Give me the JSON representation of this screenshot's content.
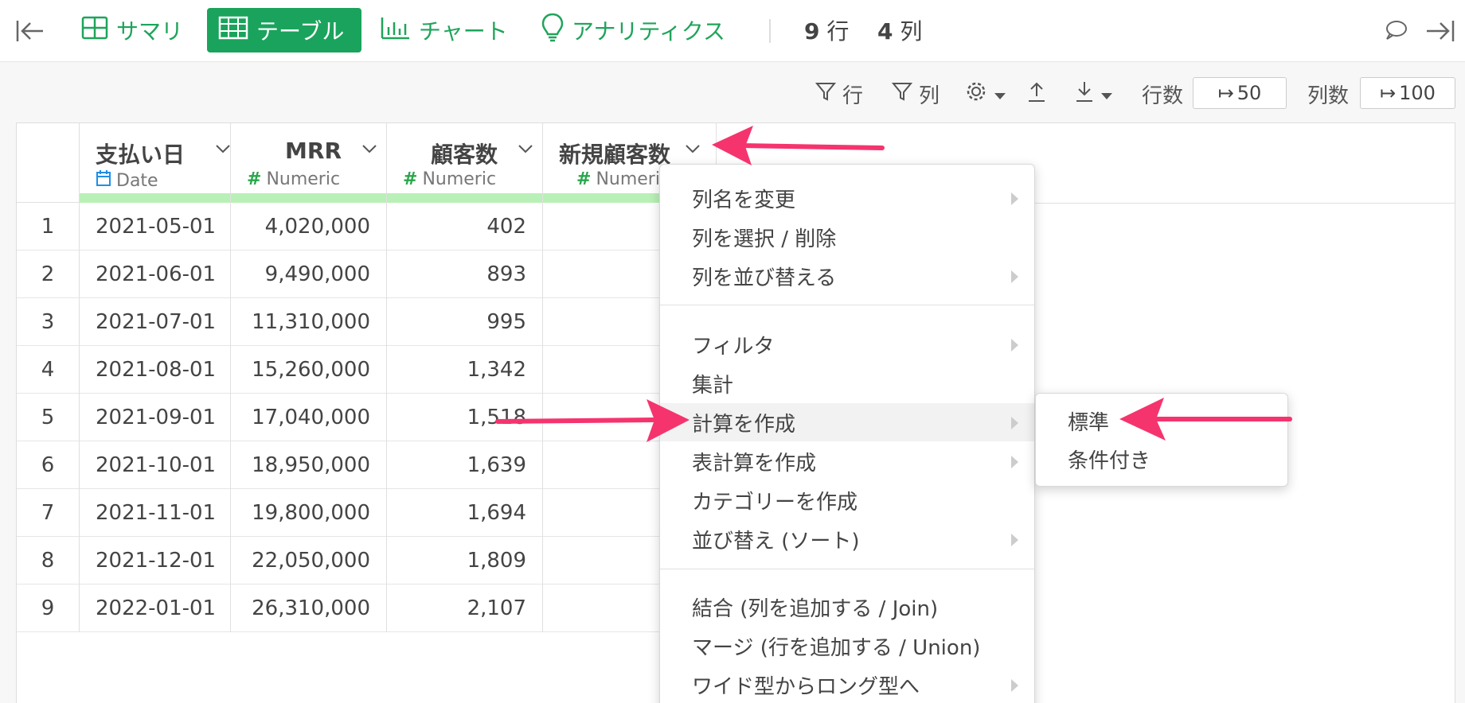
{
  "nav": {
    "summary": "サマリ",
    "table": "テーブル",
    "chart": "チャート",
    "analytics": "アナリティクス",
    "rows_count": "9",
    "rows_unit": "行",
    "cols_count": "4",
    "cols_unit": "列"
  },
  "toolbar": {
    "row_filter": "行",
    "col_filter": "列",
    "rows_label": "行数",
    "rows_value": "50",
    "cols_label": "列数",
    "cols_value": "100"
  },
  "table": {
    "columns": [
      {
        "name": "支払い日",
        "type": "Date"
      },
      {
        "name": "MRR",
        "type": "Numeric"
      },
      {
        "name": "顧客数",
        "type": "Numeric"
      },
      {
        "name": "新規顧客数",
        "type": "Numeri"
      }
    ],
    "rows": [
      {
        "n": "1",
        "date": "2021-05-01",
        "mrr": "4,020,000",
        "cust": "402"
      },
      {
        "n": "2",
        "date": "2021-06-01",
        "mrr": "9,490,000",
        "cust": "893"
      },
      {
        "n": "3",
        "date": "2021-07-01",
        "mrr": "11,310,000",
        "cust": "995"
      },
      {
        "n": "4",
        "date": "2021-08-01",
        "mrr": "15,260,000",
        "cust": "1,342"
      },
      {
        "n": "5",
        "date": "2021-09-01",
        "mrr": "17,040,000",
        "cust": "1,518"
      },
      {
        "n": "6",
        "date": "2021-10-01",
        "mrr": "18,950,000",
        "cust": "1,639"
      },
      {
        "n": "7",
        "date": "2021-11-01",
        "mrr": "19,800,000",
        "cust": "1,694"
      },
      {
        "n": "8",
        "date": "2021-12-01",
        "mrr": "22,050,000",
        "cust": "1,809"
      },
      {
        "n": "9",
        "date": "2022-01-01",
        "mrr": "26,310,000",
        "cust": "2,107"
      }
    ]
  },
  "menu": {
    "items": [
      "列名を変更",
      "列を選択 / 削除",
      "列を並び替える",
      "フィルタ",
      "集計",
      "計算を作成",
      "表計算を作成",
      "カテゴリーを作成",
      "並び替え (ソート)",
      "結合 (列を追加する / Join)",
      "マージ (行を追加する / Union)",
      "ワイド型からロング型へ"
    ]
  },
  "submenu": {
    "items": [
      "標準",
      "条件付き"
    ]
  },
  "colors": {
    "accent": "#1aa35c",
    "annotation": "#f5346e"
  }
}
